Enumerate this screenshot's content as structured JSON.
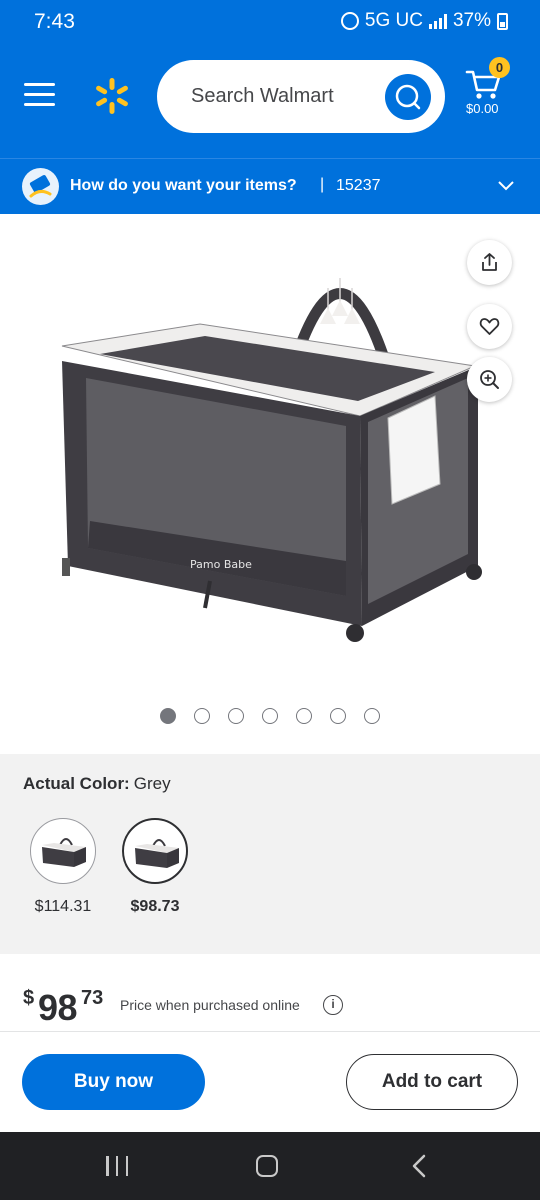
{
  "status_bar": {
    "time": "7:43",
    "network": "5G UC",
    "battery": "37%"
  },
  "header": {
    "search_placeholder": "Search Walmart",
    "cart_count": "0",
    "cart_total": "$0.00",
    "brand_color": "#0071dc",
    "accent_color": "#ffc220"
  },
  "delivery": {
    "prompt": "How do you want your items?",
    "separator": "|",
    "zip": "15237"
  },
  "product": {
    "brand_mark": "Pamo Babe",
    "image_count": 7,
    "active_image": 0
  },
  "color_option": {
    "label": "Actual Color:",
    "value": "Grey",
    "swatches": [
      {
        "price": "$114.31",
        "selected": false
      },
      {
        "price": "$98.73",
        "selected": true
      }
    ]
  },
  "price": {
    "currency": "$",
    "dollars": "98",
    "cents": "73",
    "note": "Price when purchased online"
  },
  "actions": {
    "buy_now": "Buy now",
    "add_to_cart": "Add to cart"
  }
}
